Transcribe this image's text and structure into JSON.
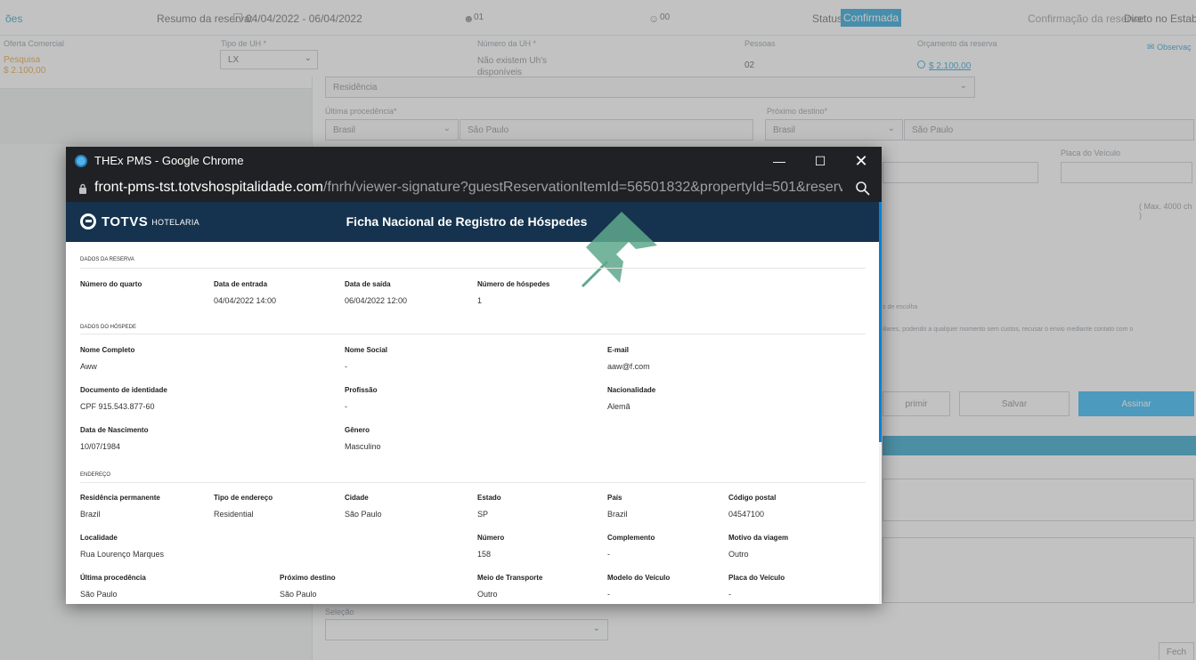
{
  "background": {
    "topbar": {
      "left_text": "ões",
      "summary_label": "Resumo da reserva:",
      "summary_dates": "04/04/2022 - 06/04/2022",
      "adults": "01",
      "children": "00",
      "status_label": "Status:",
      "status_value": "Confirmada",
      "confirmation_label": "Confirmação da reserva:",
      "confirmation_value": "Direto no Estabelecime"
    },
    "row": {
      "offer_label": "Oferta Comercial",
      "offer_value1": "Pesquisa",
      "offer_value2": "$ 2.100,00",
      "uh_type_label": "Tipo de UH *",
      "uh_type_value": "LX",
      "uh_number_label": "Número da UH *",
      "uh_number_value": "Não existem Uh's disponíveis",
      "persons_label": "Pessoas",
      "persons_value": "02",
      "budget_label": "Orçamento da reserva",
      "budget_value": "$ 2.100,00",
      "notes_label": "Observaç"
    },
    "form": {
      "residence_placeholder": "Residência",
      "last_origin_label": "Última procedência*",
      "last_origin_country": "Brasil",
      "last_origin_city": "São Paulo",
      "next_dest_label": "Próximo destino*",
      "next_dest_country": "Brasil",
      "next_dest_city": "São Paulo",
      "plate_label": "Placa do Veículo",
      "max_chars": "( Max. 4000 ch )",
      "choice_text": "s de escolha",
      "consent_text": "iliares, podendo a qualquer momento sem custos, recusar o envio mediante contato com o",
      "btn_print": "primir",
      "btn_save": "Salvar",
      "btn_sign": "Assinar",
      "selection_label": "Seleção",
      "bottom_btn": "Fech"
    }
  },
  "window": {
    "title": "THEx PMS - Google Chrome",
    "url_host": "front-pms-tst.totvshospitalidade.com",
    "url_path": "/fnrh/viewer-signature?guestReservationItemId=56501832&propertyId=501&reservati..."
  },
  "document": {
    "brand": "TOTVS",
    "brand_sub": "HOTELARIA",
    "title": "Ficha Nacional de Registro de Hóspedes",
    "reservation_section": "DADOS DA RESERVA",
    "reservation": {
      "room_label": "Número do quarto",
      "room_value": "",
      "checkin_label": "Data de entrada",
      "checkin_value": "04/04/2022 14:00",
      "checkout_label": "Data de saída",
      "checkout_value": "06/04/2022 12:00",
      "guests_label": "Número de hóspedes",
      "guests_value": "1"
    },
    "guest_section": "DADOS DO HÓSPEDE",
    "guest": {
      "name_label": "Nome Completo",
      "name_value": "Aww",
      "social_label": "Nome Social",
      "social_value": "-",
      "email_label": "E-mail",
      "email_value": "aaw@f.com",
      "doc_label": "Documento de identidade",
      "doc_value": "CPF 915.543.877-60",
      "profession_label": "Profissão",
      "profession_value": "-",
      "nationality_label": "Nacionalidade",
      "nationality_value": "Alemã",
      "birth_label": "Data de Nascimento",
      "birth_value": "10/07/1984",
      "gender_label": "Gênero",
      "gender_value": "Masculino"
    },
    "address_section": "ENDEREÇO",
    "address": {
      "residence_label": "Residência permanente",
      "residence_value": "Brazil",
      "type_label": "Tipo de endereço",
      "type_value": "Residential",
      "city_label": "Cidade",
      "city_value": "São Paulo",
      "state_label": "Estado",
      "state_value": "SP",
      "country_label": "País",
      "country_value": "Brazil",
      "postal_label": "Código postal",
      "postal_value": "04547100",
      "locality_label": "Localidade",
      "locality_value": "Rua Lourenço Marques",
      "number_label": "Número",
      "number_value": "158",
      "complement_label": "Complemento",
      "complement_value": "-",
      "reason_label": "Motivo da viagem",
      "reason_value": "Outro",
      "last_origin_label": "Última procedência",
      "last_origin_value": "São Paulo",
      "next_dest_label": "Próximo destino",
      "next_dest_value": "São Paulo",
      "transport_label": "Meio de Transporte",
      "transport_value": "Outro",
      "vehicle_model_label": "Modelo do Veículo",
      "vehicle_model_value": "-",
      "plate_label": "Placa do Veículo",
      "plate_value": "-"
    }
  },
  "colors": {
    "header": "#15334e",
    "chrome_dark": "#202124",
    "pin": "#5ea88c",
    "accent": "#29b6f6"
  },
  "icons": {
    "app": "chrome-app-icon",
    "lock": "lock-icon",
    "zoom": "zoom-icon",
    "pin": "pushpin-icon"
  }
}
